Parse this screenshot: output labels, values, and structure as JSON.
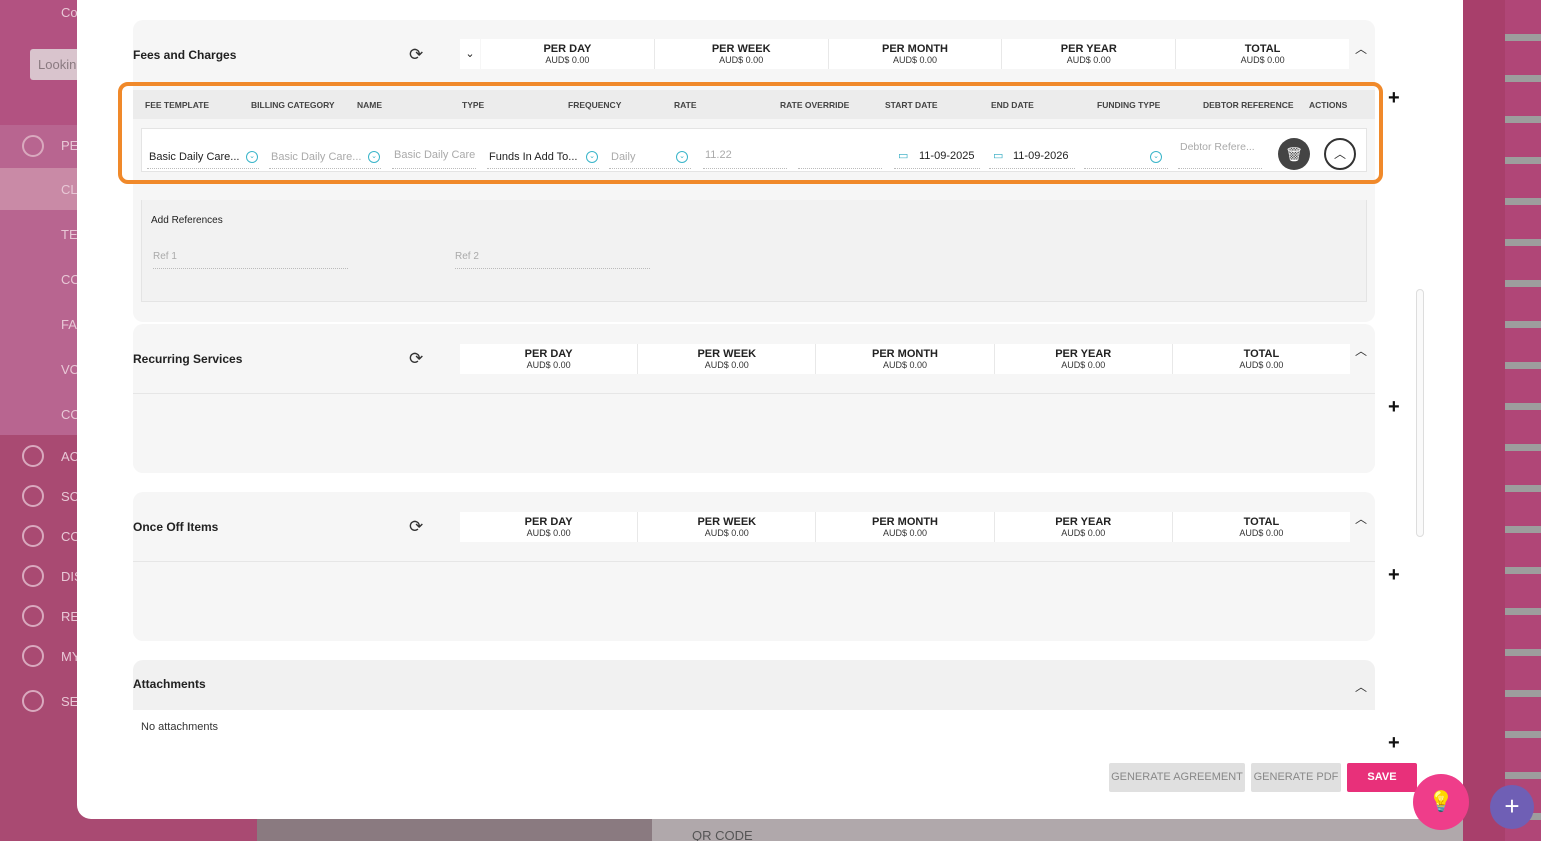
{
  "background": {
    "search_text": "Lookin",
    "sidebar_items": [
      "Co",
      "PE",
      "CL",
      "TE",
      "CO",
      "FA",
      "VO",
      "CO",
      "AC",
      "SC",
      "CO",
      "DIS",
      "RE",
      "MY",
      "SE"
    ],
    "bottom_text": "QR CODE"
  },
  "fees": {
    "title": "Fees and Charges",
    "summary": [
      {
        "label": "PER DAY",
        "value": "AUD$ 0.00"
      },
      {
        "label": "PER WEEK",
        "value": "AUD$ 0.00"
      },
      {
        "label": "PER MONTH",
        "value": "AUD$ 0.00"
      },
      {
        "label": "PER YEAR",
        "value": "AUD$ 0.00"
      },
      {
        "label": "TOTAL",
        "value": "AUD$ 0.00"
      }
    ],
    "columns": [
      "FEE TEMPLATE",
      "BILLING CATEGORY",
      "NAME",
      "TYPE",
      "FREQUENCY",
      "RATE",
      "RATE OVERRIDE",
      "START DATE",
      "END DATE",
      "FUNDING TYPE",
      "DEBTOR REFERENCE",
      "ACTIONS"
    ],
    "row": {
      "fee_template": "Basic Daily Care...",
      "billing_category": "Basic Daily Care...",
      "name": "Basic Daily Care",
      "type": "Funds In Add To...",
      "frequency": "Daily",
      "rate": "11.22",
      "start_date": "11-09-2025",
      "end_date": "11-09-2026",
      "debtor_placeholder": "Debtor Refere..."
    },
    "refs": {
      "title": "Add References",
      "ref1": "Ref 1",
      "ref2": "Ref 2"
    }
  },
  "recurring": {
    "title": "Recurring Services",
    "summary": [
      {
        "label": "PER DAY",
        "value": "AUD$ 0.00"
      },
      {
        "label": "PER WEEK",
        "value": "AUD$ 0.00"
      },
      {
        "label": "PER MONTH",
        "value": "AUD$ 0.00"
      },
      {
        "label": "PER YEAR",
        "value": "AUD$ 0.00"
      },
      {
        "label": "TOTAL",
        "value": "AUD$ 0.00"
      }
    ]
  },
  "onceoff": {
    "title": "Once Off Items",
    "summary": [
      {
        "label": "PER DAY",
        "value": "AUD$ 0.00"
      },
      {
        "label": "PER WEEK",
        "value": "AUD$ 0.00"
      },
      {
        "label": "PER MONTH",
        "value": "AUD$ 0.00"
      },
      {
        "label": "PER YEAR",
        "value": "AUD$ 0.00"
      },
      {
        "label": "TOTAL",
        "value": "AUD$ 0.00"
      }
    ]
  },
  "attachments": {
    "title": "Attachments",
    "empty": "No attachments"
  },
  "footer": {
    "generate_agreement": "GENERATE AGREEMENT",
    "generate_pdf": "GENERATE PDF",
    "save": "SAVE"
  },
  "icons": {
    "refresh": "refresh-icon",
    "chevron_up": "chevron-up-icon",
    "chevron_down": "chevron-down-icon",
    "plus": "plus-icon",
    "calendar": "calendar-icon",
    "trash": "trash-icon",
    "bulb": "lightbulb-icon"
  },
  "colors": {
    "highlight": "#f0892a",
    "save": "#e8307a",
    "accent": "#3ab5c9"
  }
}
